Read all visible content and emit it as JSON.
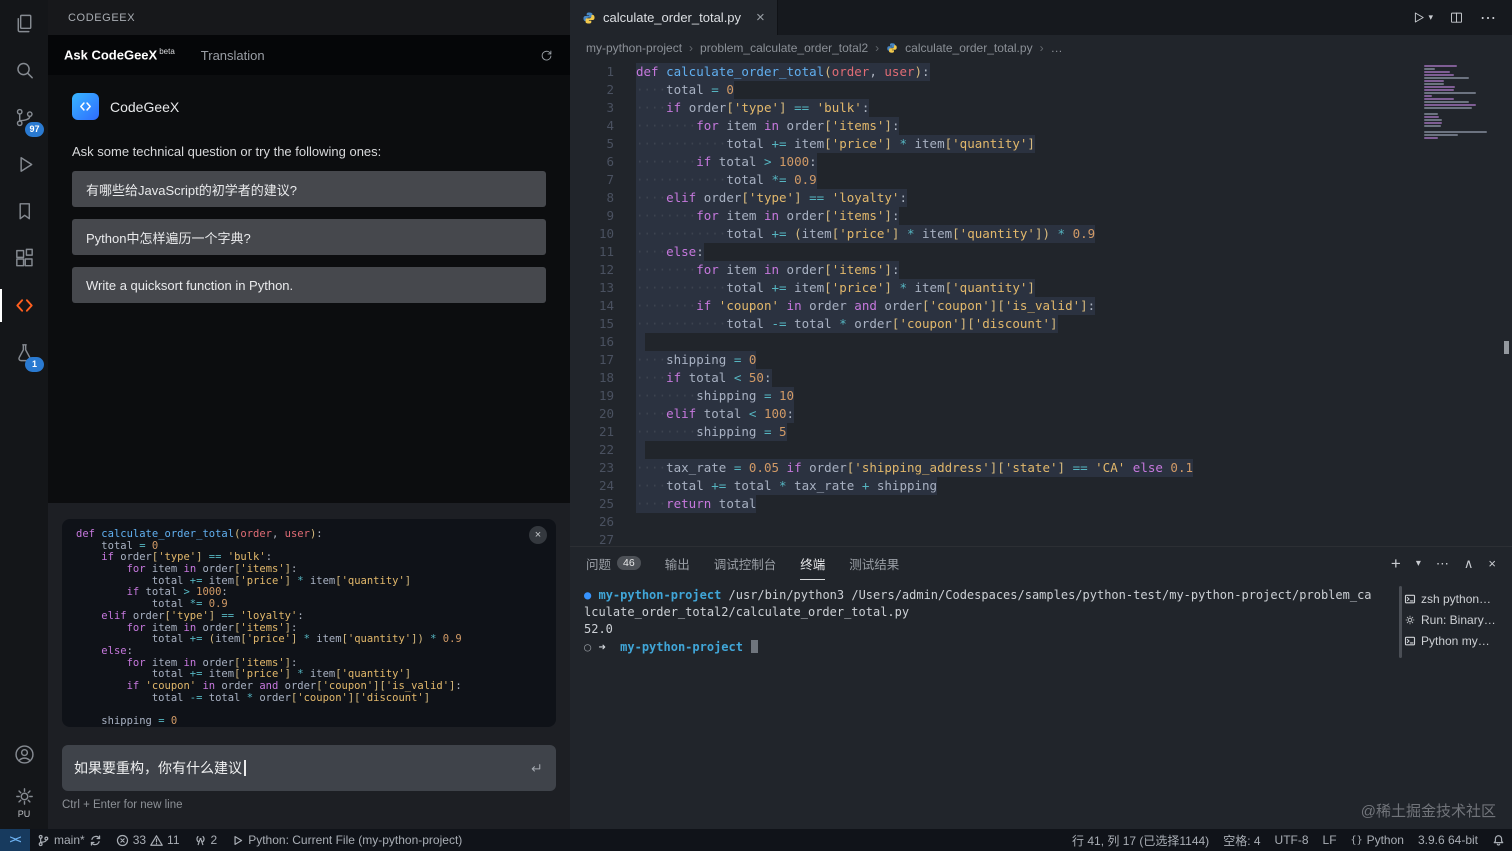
{
  "activity_bar": {
    "items": [
      {
        "id": "explorer",
        "icon": "files"
      },
      {
        "id": "search",
        "icon": "search"
      },
      {
        "id": "source-control",
        "icon": "scm",
        "badge": "97"
      },
      {
        "id": "run-debug",
        "icon": "debug"
      },
      {
        "id": "bookmarks",
        "icon": "bookmark"
      },
      {
        "id": "extensions",
        "icon": "ext"
      },
      {
        "id": "codegeex",
        "icon": "codegeex",
        "active": true
      },
      {
        "id": "testing",
        "icon": "flask",
        "badge": "1"
      }
    ],
    "bottom": [
      {
        "id": "accounts",
        "icon": "account"
      },
      {
        "id": "settings",
        "icon": "gear",
        "label": "PU"
      }
    ]
  },
  "sidebar": {
    "title": "CODEGEEX",
    "tabs": [
      {
        "label": "Ask CodeGeeX",
        "sup": "beta",
        "active": true
      },
      {
        "label": "Translation"
      }
    ],
    "brand": "CodeGeeX",
    "prompt_hint": "Ask some technical question or try the following ones:",
    "suggestions": [
      "有哪些给JavaScript的初学者的建议?",
      "Python中怎样遍历一个字典?",
      "Write a quicksort function in Python."
    ],
    "input": {
      "value": "如果要重构，你有什么建议",
      "hint": "Ctrl + Enter for new line"
    }
  },
  "editor": {
    "tab": {
      "title": "calculate_order_total.py"
    },
    "breadcrumbs": [
      "my-python-project",
      "problem_calculate_order_total2",
      "calculate_order_total.py",
      "…"
    ],
    "lines": [
      {
        "sel": 1,
        "tk": [
          [
            "k",
            "def "
          ],
          [
            "f",
            "calculate_order_total"
          ],
          [
            "b",
            "("
          ],
          [
            "p",
            "order"
          ],
          [
            "t",
            ", "
          ],
          [
            "p",
            "user"
          ],
          [
            "b",
            ")"
          ],
          [
            "t",
            ":"
          ]
        ]
      },
      {
        "sel": 1,
        "tk": [
          [
            "w",
            "    "
          ],
          [
            "v",
            "total"
          ],
          [
            "o",
            " = "
          ],
          [
            "n",
            "0"
          ]
        ]
      },
      {
        "sel": 1,
        "tk": [
          [
            "w",
            "    "
          ],
          [
            "k",
            "if "
          ],
          [
            "v",
            "order"
          ],
          [
            "b",
            "["
          ],
          [
            "s",
            "'type'"
          ],
          [
            "b",
            "]"
          ],
          [
            "o",
            " == "
          ],
          [
            "s",
            "'bulk'"
          ],
          [
            "t",
            ":"
          ]
        ]
      },
      {
        "sel": 1,
        "tk": [
          [
            "w",
            "        "
          ],
          [
            "k",
            "for "
          ],
          [
            "v",
            "item"
          ],
          [
            "k",
            " in "
          ],
          [
            "v",
            "order"
          ],
          [
            "b",
            "["
          ],
          [
            "s",
            "'items'"
          ],
          [
            "b",
            "]"
          ],
          [
            "t",
            ":"
          ]
        ]
      },
      {
        "sel": 1,
        "tk": [
          [
            "w",
            "            "
          ],
          [
            "v",
            "total"
          ],
          [
            "o",
            " += "
          ],
          [
            "v",
            "item"
          ],
          [
            "b",
            "["
          ],
          [
            "s",
            "'price'"
          ],
          [
            "b",
            "]"
          ],
          [
            "o",
            " * "
          ],
          [
            "v",
            "item"
          ],
          [
            "b",
            "["
          ],
          [
            "s",
            "'quantity'"
          ],
          [
            "b",
            "]"
          ]
        ]
      },
      {
        "sel": 1,
        "tk": [
          [
            "w",
            "        "
          ],
          [
            "k",
            "if "
          ],
          [
            "v",
            "total"
          ],
          [
            "o",
            " > "
          ],
          [
            "n",
            "1000"
          ],
          [
            "t",
            ":"
          ]
        ]
      },
      {
        "sel": 1,
        "tk": [
          [
            "w",
            "            "
          ],
          [
            "v",
            "total"
          ],
          [
            "o",
            " *= "
          ],
          [
            "n",
            "0.9"
          ]
        ]
      },
      {
        "sel": 1,
        "tk": [
          [
            "w",
            "    "
          ],
          [
            "k",
            "elif "
          ],
          [
            "v",
            "order"
          ],
          [
            "b",
            "["
          ],
          [
            "s",
            "'type'"
          ],
          [
            "b",
            "]"
          ],
          [
            "o",
            " == "
          ],
          [
            "s",
            "'loyalty'"
          ],
          [
            "t",
            ":"
          ]
        ]
      },
      {
        "sel": 1,
        "tk": [
          [
            "w",
            "        "
          ],
          [
            "k",
            "for "
          ],
          [
            "v",
            "item"
          ],
          [
            "k",
            " in "
          ],
          [
            "v",
            "order"
          ],
          [
            "b",
            "["
          ],
          [
            "s",
            "'items'"
          ],
          [
            "b",
            "]"
          ],
          [
            "t",
            ":"
          ]
        ]
      },
      {
        "sel": 1,
        "tk": [
          [
            "w",
            "            "
          ],
          [
            "v",
            "total"
          ],
          [
            "o",
            " += "
          ],
          [
            "b",
            "("
          ],
          [
            "v",
            "item"
          ],
          [
            "b",
            "["
          ],
          [
            "s",
            "'price'"
          ],
          [
            "b",
            "]"
          ],
          [
            "o",
            " * "
          ],
          [
            "v",
            "item"
          ],
          [
            "b",
            "["
          ],
          [
            "s",
            "'quantity'"
          ],
          [
            "b",
            "])"
          ],
          [
            "o",
            " * "
          ],
          [
            "n",
            "0.9"
          ]
        ]
      },
      {
        "sel": 1,
        "tk": [
          [
            "w",
            "    "
          ],
          [
            "k",
            "else"
          ],
          [
            "t",
            ":"
          ]
        ]
      },
      {
        "sel": 1,
        "tk": [
          [
            "w",
            "        "
          ],
          [
            "k",
            "for "
          ],
          [
            "v",
            "item"
          ],
          [
            "k",
            " in "
          ],
          [
            "v",
            "order"
          ],
          [
            "b",
            "["
          ],
          [
            "s",
            "'items'"
          ],
          [
            "b",
            "]"
          ],
          [
            "t",
            ":"
          ]
        ]
      },
      {
        "sel": 1,
        "tk": [
          [
            "w",
            "            "
          ],
          [
            "v",
            "total"
          ],
          [
            "o",
            " += "
          ],
          [
            "v",
            "item"
          ],
          [
            "b",
            "["
          ],
          [
            "s",
            "'price'"
          ],
          [
            "b",
            "]"
          ],
          [
            "o",
            " * "
          ],
          [
            "v",
            "item"
          ],
          [
            "b",
            "["
          ],
          [
            "s",
            "'quantity'"
          ],
          [
            "b",
            "]"
          ]
        ]
      },
      {
        "sel": 1,
        "tk": [
          [
            "w",
            "        "
          ],
          [
            "k",
            "if "
          ],
          [
            "s",
            "'coupon'"
          ],
          [
            "k",
            " in "
          ],
          [
            "v",
            "order"
          ],
          [
            "k",
            " and "
          ],
          [
            "v",
            "order"
          ],
          [
            "b",
            "["
          ],
          [
            "s",
            "'coupon'"
          ],
          [
            "b",
            "]["
          ],
          [
            "s",
            "'is_valid'"
          ],
          [
            "b",
            "]"
          ],
          [
            "t",
            ":"
          ]
        ]
      },
      {
        "sel": 1,
        "tk": [
          [
            "w",
            "            "
          ],
          [
            "v",
            "total"
          ],
          [
            "o",
            " -= "
          ],
          [
            "v",
            "total"
          ],
          [
            "o",
            " * "
          ],
          [
            "v",
            "order"
          ],
          [
            "b",
            "["
          ],
          [
            "s",
            "'coupon'"
          ],
          [
            "b",
            "]["
          ],
          [
            "s",
            "'discount'"
          ],
          [
            "b",
            "]"
          ]
        ]
      },
      {
        "sel": 1,
        "tk": []
      },
      {
        "sel": 1,
        "tk": [
          [
            "w",
            "    "
          ],
          [
            "v",
            "shipping"
          ],
          [
            "o",
            " = "
          ],
          [
            "n",
            "0"
          ]
        ]
      },
      {
        "sel": 1,
        "tk": [
          [
            "w",
            "    "
          ],
          [
            "k",
            "if "
          ],
          [
            "v",
            "total"
          ],
          [
            "o",
            " < "
          ],
          [
            "n",
            "50"
          ],
          [
            "t",
            ":"
          ]
        ]
      },
      {
        "sel": 1,
        "tk": [
          [
            "w",
            "        "
          ],
          [
            "v",
            "shipping"
          ],
          [
            "o",
            " = "
          ],
          [
            "n",
            "10"
          ]
        ]
      },
      {
        "sel": 1,
        "tk": [
          [
            "w",
            "    "
          ],
          [
            "k",
            "elif "
          ],
          [
            "v",
            "total"
          ],
          [
            "o",
            " < "
          ],
          [
            "n",
            "100"
          ],
          [
            "t",
            ":"
          ]
        ]
      },
      {
        "sel": 1,
        "tk": [
          [
            "w",
            "        "
          ],
          [
            "v",
            "shipping"
          ],
          [
            "o",
            " = "
          ],
          [
            "n",
            "5"
          ]
        ]
      },
      {
        "sel": 1,
        "tk": []
      },
      {
        "sel": 1,
        "tk": [
          [
            "w",
            "    "
          ],
          [
            "v",
            "tax_rate"
          ],
          [
            "o",
            " = "
          ],
          [
            "n",
            "0.05"
          ],
          [
            "k",
            " if "
          ],
          [
            "v",
            "order"
          ],
          [
            "b",
            "["
          ],
          [
            "s",
            "'shipping_address'"
          ],
          [
            "b",
            "]["
          ],
          [
            "s",
            "'state'"
          ],
          [
            "b",
            "]"
          ],
          [
            "o",
            " == "
          ],
          [
            "s",
            "'CA'"
          ],
          [
            "k",
            " else "
          ],
          [
            "n",
            "0.1"
          ]
        ]
      },
      {
        "sel": 1,
        "tk": [
          [
            "w",
            "    "
          ],
          [
            "v",
            "total"
          ],
          [
            "o",
            " += "
          ],
          [
            "v",
            "total"
          ],
          [
            "o",
            " * "
          ],
          [
            "v",
            "tax_rate"
          ],
          [
            "o",
            " + "
          ],
          [
            "v",
            "shipping"
          ]
        ]
      },
      {
        "sel": 1,
        "tk": [
          [
            "w",
            "    "
          ],
          [
            "k",
            "return "
          ],
          [
            "v",
            "total"
          ]
        ]
      },
      {
        "sel": 0,
        "tk": []
      },
      {
        "sel": 0,
        "tk": []
      }
    ]
  },
  "panel": {
    "tabs": [
      {
        "id": "problems",
        "label": "问题",
        "badge": "46"
      },
      {
        "id": "output",
        "label": "输出"
      },
      {
        "id": "debug-console",
        "label": "调试控制台"
      },
      {
        "id": "terminal",
        "label": "终端",
        "active": true
      },
      {
        "id": "test-results",
        "label": "测试结果"
      }
    ],
    "terminal_lines": [
      {
        "seg": [
          [
            "dot",
            "●"
          ],
          [
            "plain",
            " "
          ],
          [
            "name",
            "my-python-project"
          ],
          [
            "plain",
            " /usr/bin/python3 /Users/admin/Codespaces/samples/python-test/my-python-project/problem_calculate_order_total2/calculate_order_total.py"
          ]
        ]
      },
      {
        "seg": [
          [
            "plain",
            "52.0"
          ]
        ]
      },
      {
        "seg": [
          [
            "dim",
            "○"
          ],
          [
            "plain",
            " "
          ],
          [
            "arrow",
            "➜"
          ],
          [
            "plain",
            "  "
          ],
          [
            "name",
            "my-python-project"
          ],
          [
            "cursor",
            ""
          ]
        ]
      }
    ],
    "process_list": [
      {
        "icon": "term",
        "label": "zsh python…"
      },
      {
        "icon": "gear",
        "label": "Run: Binary…"
      },
      {
        "icon": "term",
        "label": "Python my…"
      }
    ]
  },
  "status_bar": {
    "remote": "><",
    "branch": "main*",
    "errors": "33",
    "warnings": "11",
    "ports": "2",
    "python_env": "Python: Current File (my-python-project)",
    "line_col": "行 41, 列 17 (已选择1144)",
    "indent": "空格: 4",
    "encoding": "UTF-8",
    "eol": "LF",
    "lang_icon": "{}",
    "language": "Python",
    "interpreter": "3.9.6 64-bit"
  },
  "watermark": "@稀土掘金技术社区",
  "colors": {
    "accent_orange": "#ff5f1f",
    "badge_blue": "#2a7ad1",
    "selection": "#2b3240",
    "terminal_name_blue": "#40a6d8"
  }
}
